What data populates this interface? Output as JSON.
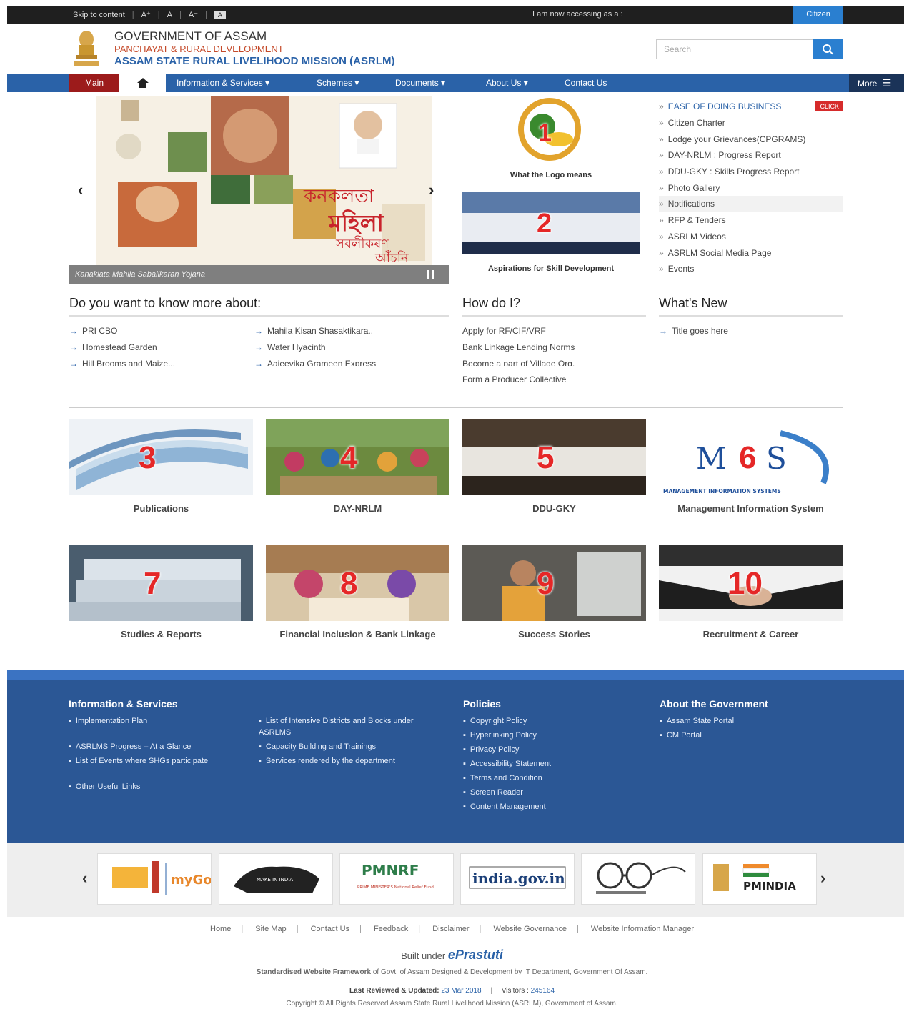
{
  "topbar": {
    "skip": "Skip to content",
    "font_sizes": [
      "A⁺",
      "A",
      "A⁻"
    ],
    "contrast": "A",
    "access_text": "I am now accessing as a :",
    "citizen_btn": "Citizen"
  },
  "header": {
    "gov": "GOVERNMENT OF ASSAM",
    "dept": "PANCHAYAT & RURAL DEVELOPMENT",
    "mission": "ASSAM STATE RURAL LIVELIHOOD MISSION (ASRLM)",
    "search_placeholder": "Search"
  },
  "nav": {
    "main": "Main",
    "items": [
      "Information & Services ▾",
      "Schemes ▾",
      "Documents ▾",
      "About Us ▾",
      "Contact Us"
    ],
    "more": "More"
  },
  "slider": {
    "caption": "Kanaklata Mahila Sabalikaran Yojana",
    "assamese_1": "কনকলতা",
    "assamese_2": "মহিলা",
    "assamese_3": "সবলীকৰণ",
    "assamese_4": "আঁচনি"
  },
  "center_cards": [
    {
      "num": "1",
      "label": "What the Logo means"
    },
    {
      "num": "2",
      "label": "Aspirations for Skill Development"
    }
  ],
  "quick_links": {
    "first": "EASE OF DOING BUSINESS",
    "badge": "CLICK",
    "items": [
      "Citizen Charter",
      "Lodge your Grievances(CPGRAMS)",
      "DAY-NRLM : Progress Report",
      "DDU-GKY : Skills Progress Report",
      "Photo Gallery",
      "Notifications",
      "RFP & Tenders",
      "ASRLM Videos",
      "ASRLM Social Media Page",
      "Events"
    ]
  },
  "know_more": {
    "title": "Do you want to know more about:",
    "col1": [
      "PRI CBO",
      "Homestead Garden",
      "Hill Brooms and Maize..."
    ],
    "col2": [
      "Mahila Kisan Shasaktikara..",
      "Water Hyacinth",
      "Aajeevika Grameen Express"
    ]
  },
  "how_do_i": {
    "title": "How do I?",
    "items": [
      "Apply for RF/CIF/VRF",
      "Bank Linkage Lending Norms",
      "Become a part of Village Org.",
      "Form a Producer Collective"
    ]
  },
  "whats_new": {
    "title": "What's New",
    "items": [
      "Title goes here"
    ]
  },
  "tiles": [
    {
      "num": "3",
      "label": "Publications"
    },
    {
      "num": "4",
      "label": "DAY-NRLM"
    },
    {
      "num": "5",
      "label": "DDU-GKY"
    },
    {
      "num": "6",
      "label": "Management Information System",
      "mis_top": "M",
      "mis_bottom": "S",
      "mis_caption": "MANAGEMENT INFORMATION SYSTEMS"
    },
    {
      "num": "7",
      "label": "Studies & Reports"
    },
    {
      "num": "8",
      "label": "Financial Inclusion & Bank Linkage"
    },
    {
      "num": "9",
      "label": "Success Stories"
    },
    {
      "num": "10",
      "label": "Recruitment & Career"
    }
  ],
  "footer": {
    "info_title": "Information & Services",
    "info_col1": [
      "Implementation Plan",
      "ASRLMS Progress – At a Glance",
      "List of Events where SHGs participate",
      "Other Useful Links"
    ],
    "info_col2": [
      "List of Intensive Districts and Blocks under ASRLMS",
      "Capacity Building and Trainings",
      "Services rendered by the department"
    ],
    "policies_title": "Policies",
    "policies": [
      "Copyright Policy",
      "Hyperlinking Policy",
      "Privacy Policy",
      "Accessibility Statement",
      "Terms and Condition",
      "Screen Reader",
      "Content Management"
    ],
    "gov_title": "About the Government",
    "gov_links": [
      "Assam State Portal",
      "CM Portal"
    ]
  },
  "partners": {
    "logos": [
      "mygov",
      "make-in-india",
      "PMNRF",
      "india.gov.in",
      "swachh-bharat",
      "PMINDIA"
    ],
    "pmnrf_text": "PMNRF",
    "pmnrf_sub": "PRIME MINISTER'S National Relief Fund",
    "indiagov_text": "india.gov.in",
    "pmindia_text": "PMINDIA",
    "mygov_text": "myGov",
    "make_text": "MAKE IN INDIA"
  },
  "bottom": {
    "links": [
      "Home",
      "Site Map",
      "Contact Us",
      "Feedback",
      "Disclaimer",
      "Website Governance",
      "Website Information Manager"
    ],
    "built_under": "Built under",
    "prastuti": "ePrastuti",
    "framework_bold": "Standardised Website Framework",
    "framework_rest": " of Govt. of Assam Designed & Development by IT Department, Government Of Assam.",
    "last_reviewed_label": "Last Reviewed & Updated:",
    "last_reviewed_date": "23 Mar 2018",
    "visitors_label": "Visitors :",
    "visitors_count": "245164",
    "copyright": "Copyright © All Rights Reserved Assam State Rural Livelihood Mission (ASRLM), Government of Assam."
  },
  "colors": {
    "primary": "#2a62a8",
    "accent_red": "#9c1b1b",
    "footer_bg": "#2b5795",
    "number_red": "#e52727"
  }
}
